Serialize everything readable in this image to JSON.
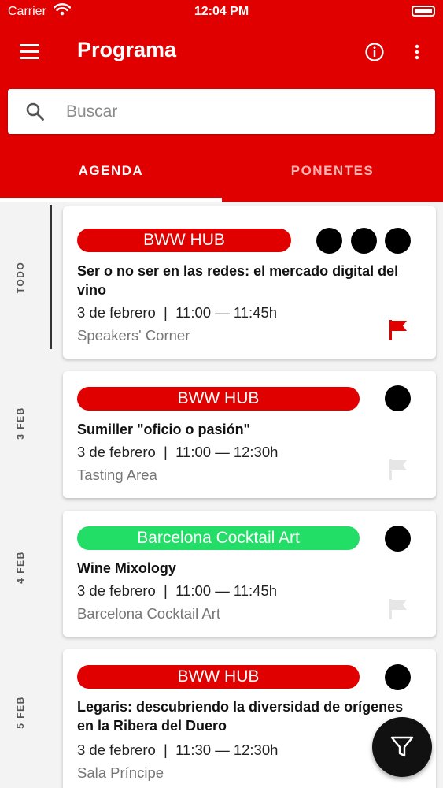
{
  "status_bar": {
    "carrier": "Carrier",
    "time": "12:04 PM"
  },
  "header": {
    "title": "Programa"
  },
  "search": {
    "placeholder": "Buscar",
    "value": ""
  },
  "tabs": [
    {
      "label": "AGENDA",
      "selected": true
    },
    {
      "label": "PONENTES",
      "selected": false
    }
  ],
  "days": [
    {
      "label": "TODO",
      "selected": true
    },
    {
      "label": "3 FEB",
      "selected": false
    },
    {
      "label": "4 FEB",
      "selected": false
    },
    {
      "label": "5 FEB",
      "selected": false
    }
  ],
  "events": [
    {
      "category": "BWW HUB",
      "category_color": "#e10000",
      "title": "Ser o no ser en las redes: el mercado digital del vino",
      "datetime": "3 de febrero  |  11:00 — 11:45h",
      "location": "Speakers' Corner",
      "flagged": true
    },
    {
      "category": "BWW HUB",
      "category_color": "#e10000",
      "title": "Sumiller \"oficio o pasión\"",
      "datetime": "3 de febrero  |  11:00 — 12:30h",
      "location": "Tasting Area",
      "flagged": false
    },
    {
      "category": "Barcelona Cocktail Art",
      "category_color": "#22dd66",
      "title": "Wine Mixology",
      "datetime": "3 de febrero  |  11:00 — 11:45h",
      "location": "Barcelona Cocktail Art",
      "flagged": false
    },
    {
      "category": "BWW HUB",
      "category_color": "#e10000",
      "title": "Legaris: descubriendo la diversidad de orígenes en la Ribera del Duero",
      "datetime": "3 de febrero  |  11:30 — 12:30h",
      "location": "Sala Príncipe",
      "flagged": false
    }
  ],
  "colors": {
    "brand": "#e10000",
    "flag_active": "#e10000",
    "flag_inactive": "#e6e6e6",
    "tab_inactive": "#ffb3b3"
  },
  "icons": {
    "menu": "menu-icon",
    "info": "info-icon",
    "more": "more-vertical-icon",
    "search": "search-icon",
    "flag": "flag-icon",
    "filter": "filter-icon"
  }
}
